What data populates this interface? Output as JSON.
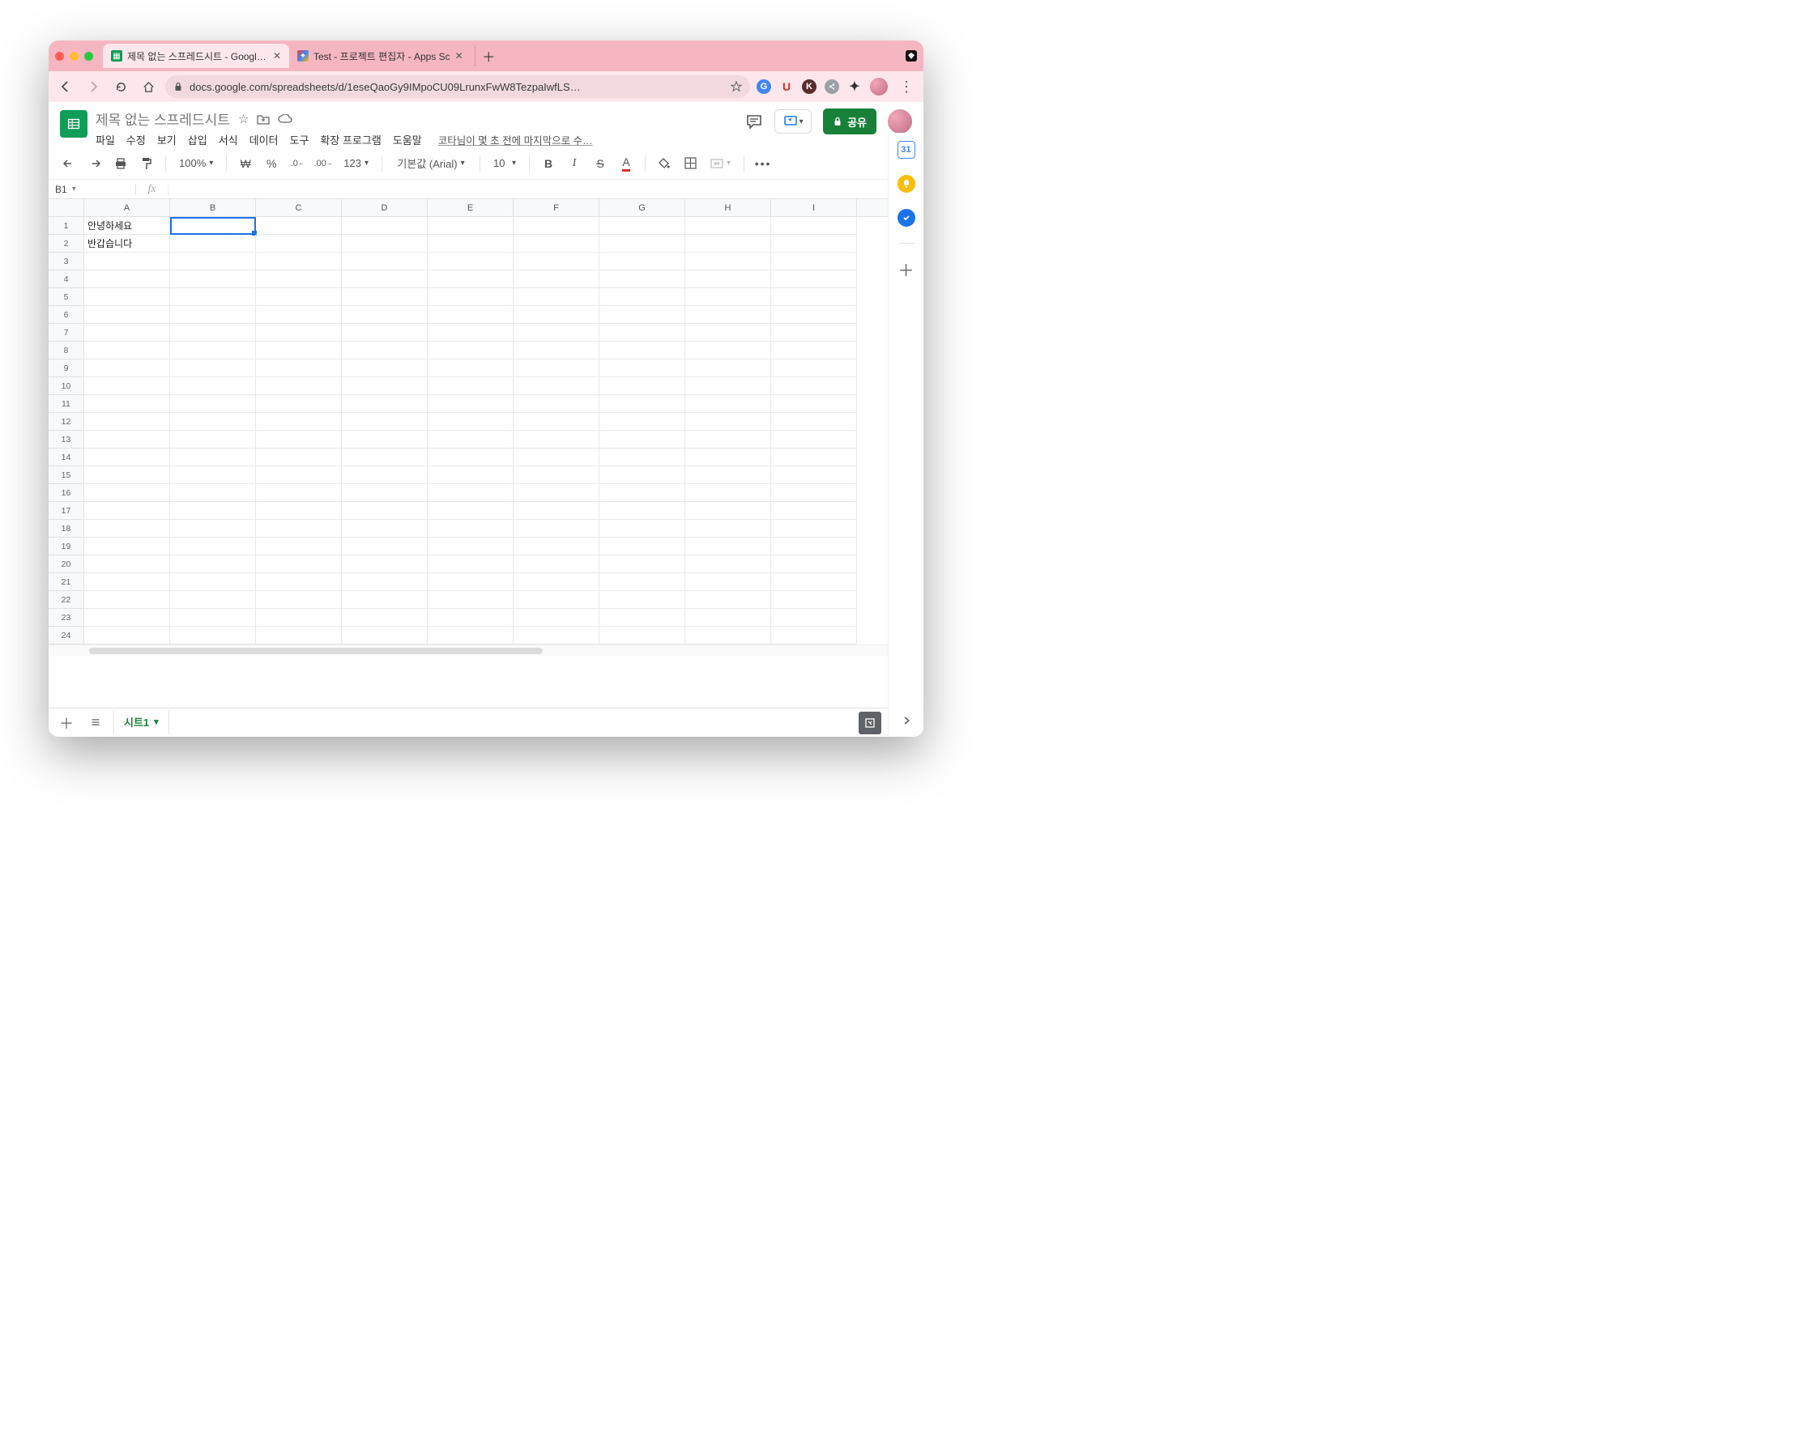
{
  "browser": {
    "tabs": [
      {
        "title": "제목 없는 스프레드시트 - Google S",
        "active": true,
        "favicon_color": "#0f9d58"
      },
      {
        "title": "Test - 프로젝트 편집자 - Apps Sc",
        "active": false,
        "favicon_color": "#f4b400"
      }
    ],
    "url": "docs.google.com/spreadsheets/d/1eseQaoGy9IMpoCU09LrunxFwW8TezpaIwfLS…",
    "extensions": {
      "translate": "G",
      "u": "U",
      "k": "K"
    }
  },
  "app": {
    "doc_title": "제목 없는 스프레드시트",
    "menus": [
      "파일",
      "수정",
      "보기",
      "삽입",
      "서식",
      "데이터",
      "도구",
      "확장 프로그램",
      "도움말"
    ],
    "last_edit": "코타님이 몇 초 전에 마지막으로 수…",
    "share_label": "공유"
  },
  "toolbar": {
    "zoom": "100%",
    "currency": "₩",
    "percent": "%",
    "dec_dec": ".0",
    "dec_inc": ".00",
    "format123": "123",
    "font": "기본값 (Arial)",
    "font_size": "10",
    "text_color_accent": "#d93025"
  },
  "namebox": "B1",
  "formula_value": "",
  "columns": [
    "A",
    "B",
    "C",
    "D",
    "E",
    "F",
    "G",
    "H",
    "I"
  ],
  "row_count": 24,
  "cells": {
    "A1": "안녕하세요",
    "A2": "반갑습니다"
  },
  "selected_cell": "B1",
  "sheets": {
    "active_name": "시트1"
  },
  "sidepanel": {
    "calendar_day": "31"
  }
}
